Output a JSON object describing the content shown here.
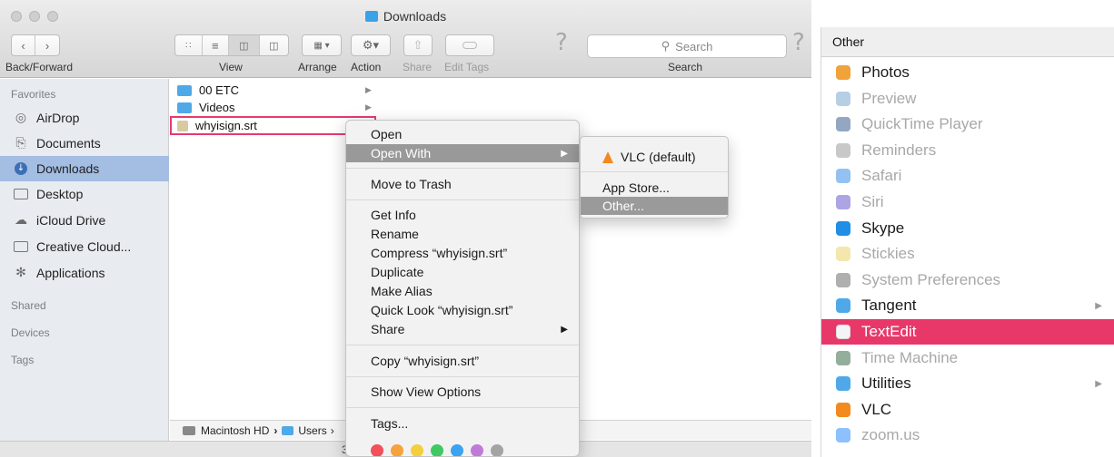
{
  "finder": {
    "window_title": "Downloads",
    "toolbar": {
      "back_forward_label": "Back/Forward",
      "view_label": "View",
      "arrange_label": "Arrange",
      "action_label": "Action",
      "share_label": "Share",
      "edit_tags_label": "Edit Tags",
      "search_label": "Search",
      "search_placeholder": "Search"
    },
    "sidebar": {
      "favorites_header": "Favorites",
      "items": [
        {
          "label": "AirDrop",
          "icon": "airdrop-icon"
        },
        {
          "label": "Documents",
          "icon": "documents-icon"
        },
        {
          "label": "Downloads",
          "icon": "downloads-icon",
          "selected": true
        },
        {
          "label": "Desktop",
          "icon": "desktop-icon"
        },
        {
          "label": "iCloud Drive",
          "icon": "cloud-icon"
        },
        {
          "label": "Creative Cloud...",
          "icon": "folder-icon"
        },
        {
          "label": "Applications",
          "icon": "applications-icon"
        }
      ],
      "shared_header": "Shared",
      "devices_header": "Devices",
      "tags_header": "Tags"
    },
    "files": [
      {
        "name": "00 ETC",
        "type": "folder"
      },
      {
        "name": "Videos",
        "type": "folder"
      },
      {
        "name": "whyisign.srt",
        "type": "file",
        "highlighted": true
      }
    ],
    "pathbar": {
      "drive": "Macintosh HD",
      "sep": "›",
      "folder": "Users",
      "trail": "›"
    },
    "status_text": "3"
  },
  "context_menu": {
    "open": "Open",
    "open_with": "Open With",
    "move_to_trash": "Move to Trash",
    "get_info": "Get Info",
    "rename": "Rename",
    "compress": "Compress “whyisign.srt”",
    "duplicate": "Duplicate",
    "make_alias": "Make Alias",
    "quick_look": "Quick Look “whyisign.srt”",
    "share": "Share",
    "copy": "Copy “whyisign.srt”",
    "show_view_options": "Show View Options",
    "tags": "Tags...",
    "tag_colors": [
      "#f2505a",
      "#f7a23b",
      "#f5cf3b",
      "#3fc962",
      "#3aa3f2",
      "#c07bd8",
      "#a4a4a4"
    ]
  },
  "open_with_menu": {
    "vlc": "VLC (default)",
    "app_store": "App Store...",
    "other": "Other..."
  },
  "chooser": {
    "header": "Other",
    "apps": [
      {
        "name": "Photos",
        "state": "enabled",
        "icon": "photos-icon",
        "color": "#f1a23b"
      },
      {
        "name": "Preview",
        "state": "disabled",
        "icon": "preview-icon",
        "color": "#7ba7cf"
      },
      {
        "name": "QuickTime Player",
        "state": "disabled",
        "icon": "quicktime-icon",
        "color": "#3a5f8f"
      },
      {
        "name": "Reminders",
        "state": "disabled",
        "icon": "reminders-icon",
        "color": "#9a9a9a"
      },
      {
        "name": "Safari",
        "state": "disabled",
        "icon": "safari-icon",
        "color": "#3b8ee8"
      },
      {
        "name": "Siri",
        "state": "disabled",
        "icon": "siri-icon",
        "color": "#6a5acd"
      },
      {
        "name": "Skype",
        "state": "enabled",
        "icon": "skype-icon",
        "color": "#1f8ee6"
      },
      {
        "name": "Stickies",
        "state": "disabled",
        "icon": "stickies-icon",
        "color": "#e9d46a"
      },
      {
        "name": "System Preferences",
        "state": "disabled",
        "icon": "system-preferences-icon",
        "color": "#6e6e6e"
      },
      {
        "name": "Tangent",
        "state": "enabled",
        "icon": "folder-icon",
        "color": "#4fa9e8",
        "has_arrow": true
      },
      {
        "name": "TextEdit",
        "state": "selected",
        "icon": "textedit-icon",
        "color": "#f4f4f4"
      },
      {
        "name": "Time Machine",
        "state": "disabled",
        "icon": "time-machine-icon",
        "color": "#3d6b4a"
      },
      {
        "name": "Utilities",
        "state": "enabled",
        "icon": "utilities-folder-icon",
        "color": "#4fa9e8",
        "has_arrow": true
      },
      {
        "name": "VLC",
        "state": "enabled",
        "icon": "vlc-icon",
        "color": "#f28a1e"
      },
      {
        "name": "zoom.us",
        "state": "disabled",
        "icon": "zoom-icon",
        "color": "#2d8cff"
      }
    ]
  }
}
